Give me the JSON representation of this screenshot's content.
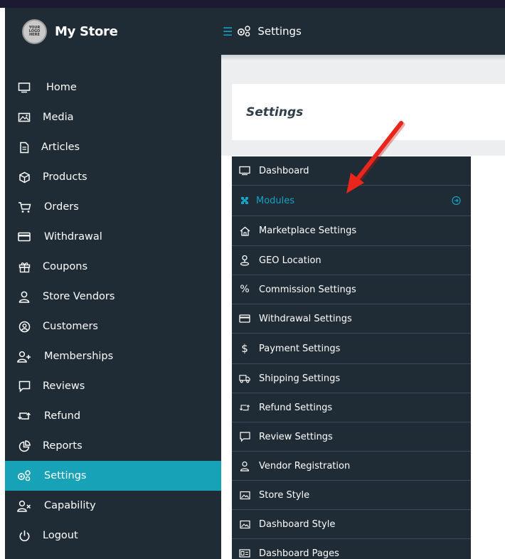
{
  "brand": {
    "name": "My Store",
    "logo_text": "YOUR LOGO HERE"
  },
  "header": {
    "title": "Settings"
  },
  "sidebar": {
    "items": [
      {
        "label": "Home",
        "icon": "monitor-icon",
        "active": false
      },
      {
        "label": "Media",
        "icon": "image-icon",
        "active": false
      },
      {
        "label": "Articles",
        "icon": "document-icon",
        "active": false
      },
      {
        "label": "Products",
        "icon": "cube-icon",
        "active": false
      },
      {
        "label": "Orders",
        "icon": "cart-icon",
        "active": false
      },
      {
        "label": "Withdrawal",
        "icon": "credit-card-icon",
        "active": false
      },
      {
        "label": "Coupons",
        "icon": "gift-icon",
        "active": false
      },
      {
        "label": "Store Vendors",
        "icon": "user-icon",
        "active": false
      },
      {
        "label": "Customers",
        "icon": "user-circle-icon",
        "active": false
      },
      {
        "label": "Memberships",
        "icon": "user-plus-icon",
        "active": false
      },
      {
        "label": "Reviews",
        "icon": "comment-icon",
        "active": false
      },
      {
        "label": "Refund",
        "icon": "retweet-icon",
        "active": false
      },
      {
        "label": "Reports",
        "icon": "pie-chart-icon",
        "active": false
      },
      {
        "label": "Settings",
        "icon": "gears-icon",
        "active": true
      },
      {
        "label": "Capability",
        "icon": "user-x-icon",
        "active": false
      },
      {
        "label": "Logout",
        "icon": "power-icon",
        "active": false
      }
    ]
  },
  "page": {
    "heading": "Settings"
  },
  "submenu": {
    "items": [
      {
        "label": "Dashboard",
        "icon": "monitor-icon",
        "active": false
      },
      {
        "label": "Modules",
        "icon": "modules-icon",
        "active": true
      },
      {
        "label": "Marketplace Settings",
        "icon": "home-icon",
        "active": false
      },
      {
        "label": "GEO Location",
        "icon": "location-icon",
        "active": false
      },
      {
        "label": "Commission Settings",
        "icon": "percent-icon",
        "active": false
      },
      {
        "label": "Withdrawal Settings",
        "icon": "credit-card-icon",
        "active": false
      },
      {
        "label": "Payment Settings",
        "icon": "dollar-icon",
        "active": false
      },
      {
        "label": "Shipping Settings",
        "icon": "truck-icon",
        "active": false
      },
      {
        "label": "Refund Settings",
        "icon": "retweet-icon",
        "active": false
      },
      {
        "label": "Review Settings",
        "icon": "comment-icon",
        "active": false
      },
      {
        "label": "Vendor Registration",
        "icon": "user-icon",
        "active": false
      },
      {
        "label": "Store Style",
        "icon": "image-icon",
        "active": false
      },
      {
        "label": "Dashboard Style",
        "icon": "image-icon",
        "active": false
      },
      {
        "label": "Dashboard Pages",
        "icon": "id-card-icon",
        "active": false
      }
    ]
  },
  "colors": {
    "sidebar_bg": "#1f2b35",
    "accent": "#17a2b8",
    "arrow": "#e8261c"
  }
}
